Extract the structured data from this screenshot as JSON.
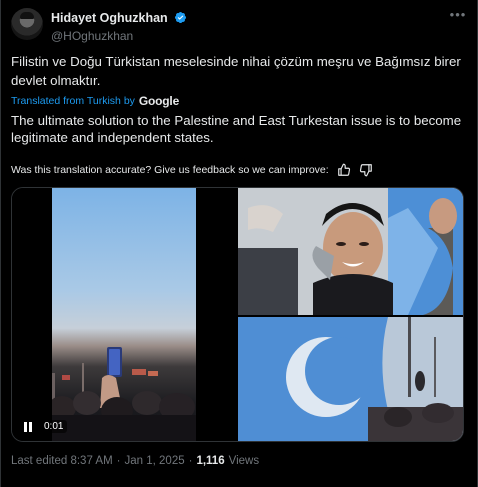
{
  "author": {
    "display_name": "Hidayet Oghuzkhan",
    "handle": "@HOghuzkhan",
    "verified": true
  },
  "post": {
    "original_text": "Filistin ve Doğu Türkistan meselesinde nihai çözüm meşru ve Bağımsız birer devlet olmaktır.",
    "translated_from_label": "Translated from Turkish by",
    "translator_name": "Google",
    "translated_text": "The ultimate solution to the Palestine and East Turkestan issue is to become legitimate and independent states.",
    "feedback_prompt": "Was this translation accurate? Give us feedback so we can improve:"
  },
  "media": {
    "video_time": "0:01"
  },
  "footer": {
    "last_edited": "Last edited 8:37 AM",
    "separator": "·",
    "date": "Jan 1, 2025",
    "views_count": "1,116",
    "views_label": "Views"
  },
  "colors": {
    "background": "#000000",
    "text_primary": "#e7e9ea",
    "text_secondary": "#71767b",
    "link_blue": "#1d9bf0",
    "flag_blue": "#5a8fd1"
  },
  "icons": [
    "verified-badge-icon",
    "more-icon",
    "thumbs-up-icon",
    "thumbs-down-icon",
    "pause-icon"
  ]
}
